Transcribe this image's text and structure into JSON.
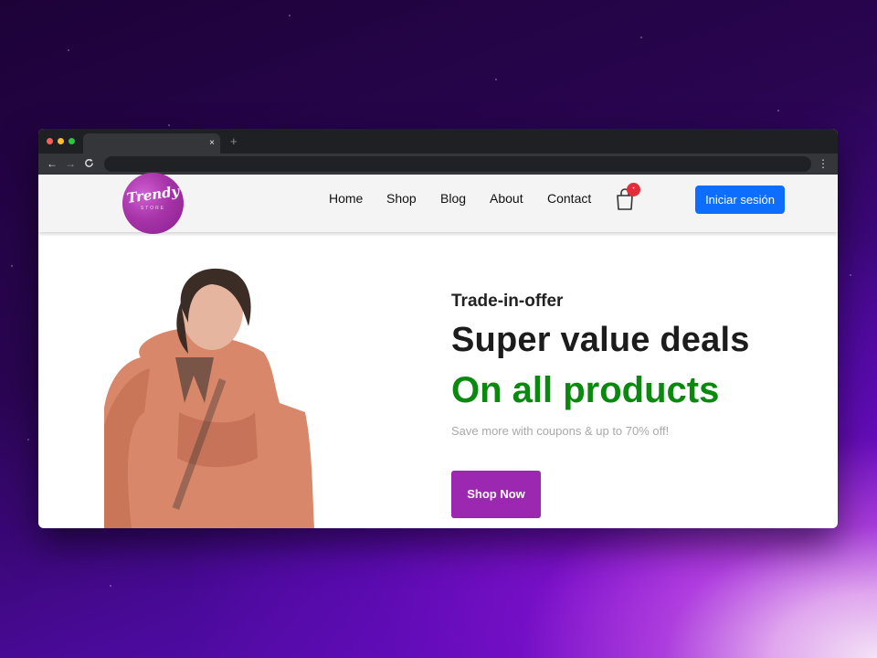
{
  "browser": {
    "tab_close": "×",
    "new_tab": "+",
    "back": "←",
    "forward": "→",
    "reload": "C",
    "menu": "⋮"
  },
  "header": {
    "logo_text": "Trendy",
    "logo_subtext": "STORE",
    "nav": [
      "Home",
      "Shop",
      "Blog",
      "About",
      "Contact"
    ],
    "cart_count": "•",
    "login_label": "Iniciar sesión"
  },
  "hero": {
    "kicker": "Trade-in-offer",
    "headline": "Super value deals",
    "subheadline": "On all products",
    "note": "Save more with coupons & up to 70% off!",
    "cta_label": "Shop Now"
  },
  "colors": {
    "accent_purple": "#9c27b0",
    "login_blue": "#0d6efd",
    "green": "#098a0e",
    "badge_red": "#e22d3a"
  },
  "icons": [
    "cart-icon",
    "close-icon",
    "plus-icon",
    "arrow-left-icon",
    "arrow-right-icon",
    "reload-icon",
    "kebab-menu-icon"
  ]
}
